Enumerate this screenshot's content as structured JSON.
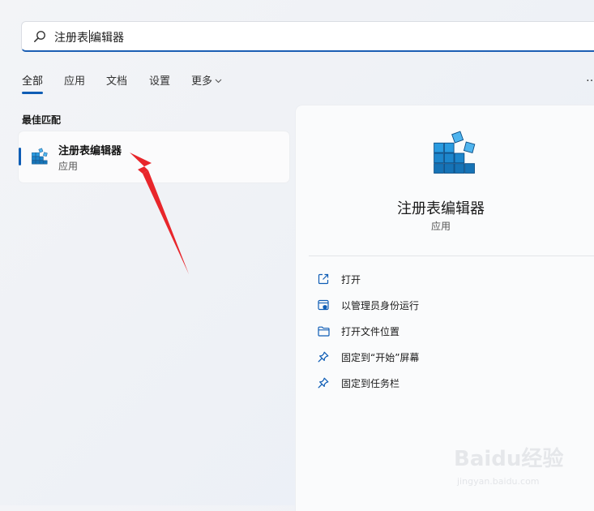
{
  "search": {
    "query": "注册表",
    "query_rest": "编辑器",
    "icon": "search-icon"
  },
  "tabs": [
    {
      "label": "全部",
      "active": true
    },
    {
      "label": "应用"
    },
    {
      "label": "文档"
    },
    {
      "label": "设置"
    },
    {
      "label": "更多",
      "has_dropdown": true
    }
  ],
  "overflow_menu": "…",
  "best_match": {
    "section_title": "最佳匹配",
    "name": "注册表编辑器",
    "kind": "应用",
    "icon": "registry-editor-icon"
  },
  "details": {
    "name": "注册表编辑器",
    "kind": "应用",
    "actions": [
      {
        "label": "打开",
        "icon": "open-external-icon"
      },
      {
        "label": "以管理员身份运行",
        "icon": "admin-shield-icon"
      },
      {
        "label": "打开文件位置",
        "icon": "folder-icon"
      },
      {
        "label": "固定到“开始”屏幕",
        "icon": "pin-icon"
      },
      {
        "label": "固定到任务栏",
        "icon": "pin-icon"
      }
    ]
  },
  "annotation": {
    "color": "#e8262b"
  },
  "watermark": {
    "text": "Baidu经验",
    "url": "jingyan.baidu.com"
  },
  "colors": {
    "accent": "#0f5db5",
    "icon_blue": "#1f8fd8"
  }
}
